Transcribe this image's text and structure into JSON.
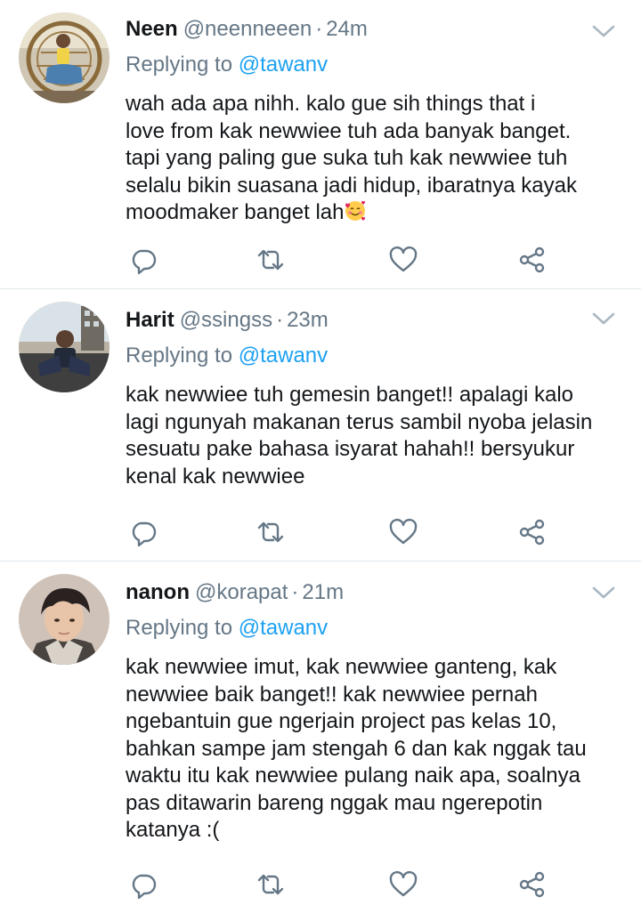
{
  "colors": {
    "text": "#14171a",
    "secondary": "#657786",
    "link": "#1da1f2",
    "divider": "#e1e8ed",
    "icon": "#657786"
  },
  "tweets": [
    {
      "display_name": "Neen",
      "handle": "@neenneeen",
      "separator": "·",
      "time": "24m",
      "replying_prefix": "Replying to",
      "replying_to": "@tawanv",
      "text": "wah ada apa nihh. kalo gue sih things that i\nlove from kak newwiee tuh ada banyak banget.\ntapi yang paling gue suka tuh kak newwiee tuh\nselalu bikin suasana jadi hidup, ibaratnya kayak\nmoodmaker banget lah",
      "emoji": "smiling-face-with-hearts",
      "avatar": "avatar-neen"
    },
    {
      "display_name": "Harit",
      "handle": "@ssingss",
      "separator": "·",
      "time": "23m",
      "replying_prefix": "Replying to",
      "replying_to": "@tawanv",
      "text": "kak newwiee tuh gemesin banget!! apalagi kalo\nlagi ngunyah makanan terus sambil nyoba jelasin\nsesuatu pake bahasa isyarat hahah!! bersyukur\nkenal kak newwiee",
      "avatar": "avatar-harit"
    },
    {
      "display_name": "nanon",
      "handle": "@korapat",
      "separator": "·",
      "time": "21m",
      "replying_prefix": "Replying to",
      "replying_to": "@tawanv",
      "text": "kak newwiee imut, kak newwiee ganteng, kak\nnewwiee baik banget!! kak newwiee pernah\nngebantuin gue ngerjain project pas kelas 10,\nbahkan sampe jam stengah 6 dan kak nggak tau\nwaktu itu kak newwiee pulang naik apa, soalnya\npas ditawarin bareng nggak mau ngerepotin\nkatanya :(",
      "avatar": "avatar-nanon"
    }
  ],
  "icons": {
    "more": "chevron-down-icon",
    "reply": "reply-icon",
    "retweet": "retweet-icon",
    "like": "heart-icon",
    "share": "share-icon"
  }
}
